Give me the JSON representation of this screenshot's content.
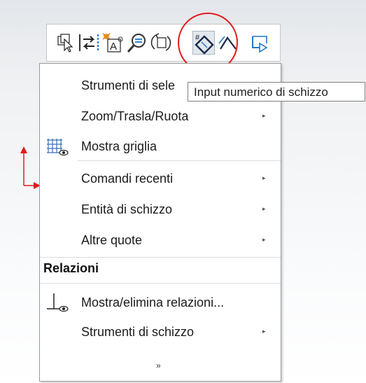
{
  "toolbar": {
    "icons": [
      "select-over-geometry-icon",
      "swap-dimension-icon",
      "smart-text-icon",
      "zoom-to-selection-icon",
      "rotate-view-icon",
      "sketch-numeric-input-icon",
      "corner-line-icon",
      "undo-arrow-icon"
    ],
    "highlight_color": "#e01c1c"
  },
  "tooltip": {
    "text": "Input numerico di schizzo"
  },
  "menu": {
    "item_select": "Strumenti di sele",
    "item_zoom": "Zoom/Trasla/Ruota",
    "item_grid": "Mostra griglia",
    "item_recent": "Comandi recenti",
    "item_entities": "Entità di schizzo",
    "item_dims": "Altre quote",
    "section_relations": "Relazioni",
    "item_show_delete": "Mostra/elimina relazioni...",
    "item_sketch_tools": "Strumenti di schizzo",
    "expand_glyph": "»"
  },
  "colors": {
    "origin": "#e01c1c"
  }
}
